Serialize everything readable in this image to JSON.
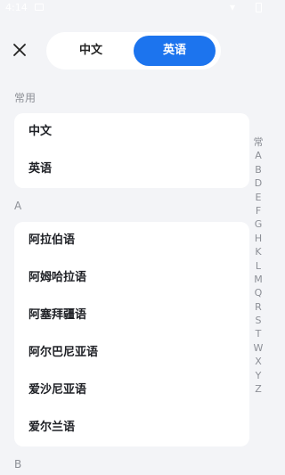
{
  "status_bar": {
    "time": "4:14",
    "icons": [
      "message-icon",
      "wifi-icon",
      "battery-icon"
    ]
  },
  "close_icon": "close-icon",
  "toggle": {
    "left_label": "中文",
    "right_label": "英语",
    "selected": "英语",
    "accent": "#1c74ee"
  },
  "sections": [
    {
      "label": "常用",
      "items": [
        "中文",
        "英语"
      ]
    },
    {
      "label": "A",
      "items": [
        "阿拉伯语",
        "阿姆哈拉语",
        "阿塞拜疆语",
        "阿尔巴尼亚语",
        "爱沙尼亚语",
        "爱尔兰语"
      ]
    },
    {
      "label": "B"
    }
  ],
  "index_bar": [
    "常",
    "A",
    "B",
    "D",
    "E",
    "F",
    "G",
    "H",
    "K",
    "L",
    "M",
    "Q",
    "R",
    "S",
    "T",
    "W",
    "X",
    "Y",
    "Z"
  ]
}
